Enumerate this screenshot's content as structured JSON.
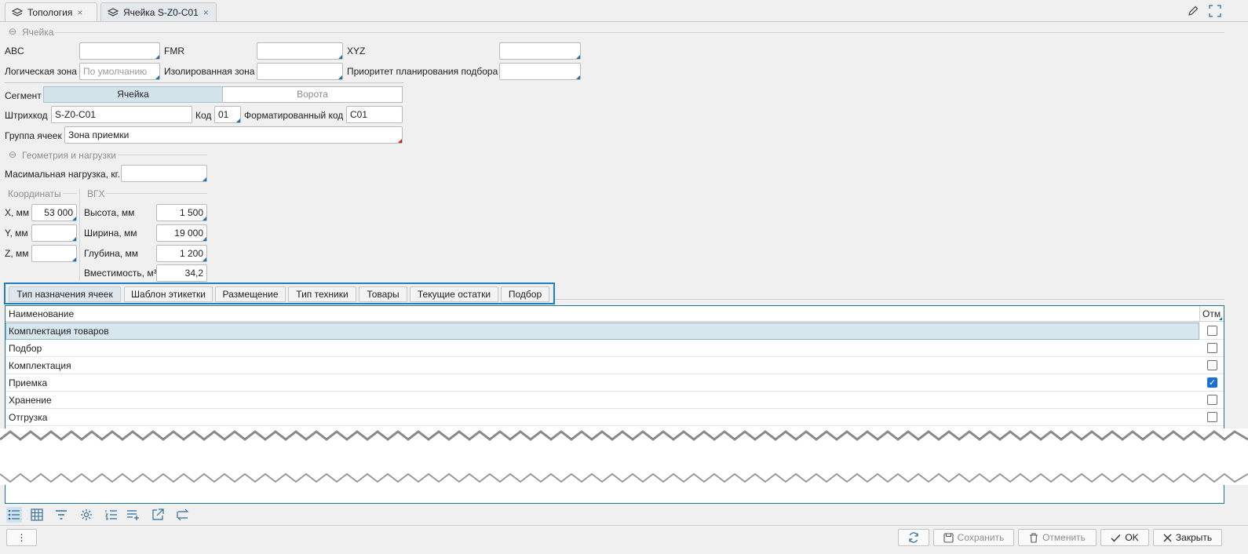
{
  "tabs": [
    {
      "label": "Топология",
      "icon": "layers-icon"
    },
    {
      "label": "Ячейка S-Z0-C01",
      "icon": "layers-icon"
    }
  ],
  "cell_section": {
    "title": "Ячейка",
    "abc_label": "ABC",
    "abc_value": "",
    "fmr_label": "FMR",
    "fmr_value": "",
    "xyz_label": "XYZ",
    "xyz_value": "",
    "logic_zone_label": "Логическая зона",
    "logic_zone_placeholder": "По умолчанию",
    "isolated_zone_label": "Изолированная зона",
    "isolated_zone_value": "",
    "priority_label": "Приоритет планирования подбора",
    "priority_value": ""
  },
  "segment": {
    "label": "Сегмент",
    "options": [
      "Ячейка",
      "Ворота"
    ],
    "selected": "Ячейка"
  },
  "barcode": {
    "label": "Штрихкод",
    "value": "S-Z0-C01"
  },
  "code": {
    "label": "Код",
    "value": "01"
  },
  "formatted_code": {
    "label": "Форматированный код",
    "value": "C01"
  },
  "cell_group": {
    "label": "Группа ячеек",
    "value": "Зона приемки"
  },
  "geometry": {
    "title": "Геометрия и нагрузки",
    "max_load_label": "Масимальная нагрузка, кг.",
    "max_load_value": "",
    "coords_title": "Координаты",
    "x_label": "X, мм",
    "x_value": "53 000",
    "y_label": "Y, мм",
    "y_value": "",
    "z_label": "Z, мм",
    "z_value": "",
    "vgh_title": "ВГХ",
    "height_label": "Высота, мм",
    "height_value": "1 500",
    "width_label": "Ширина, мм",
    "width_value": "19 000",
    "depth_label": "Глубина, мм",
    "depth_value": "1 200",
    "capacity_label": "Вместимость, м³",
    "capacity_value": "34,2"
  },
  "inner_tabs": [
    "Тип назначения ячеек",
    "Шаблон этикетки",
    "Размещение",
    "Тип техники",
    "Товары",
    "Текущие остатки",
    "Подбор"
  ],
  "grid": {
    "col_name": "Наименование",
    "col_mark": "Отм",
    "rows": [
      {
        "name": "Комплектация товаров",
        "checked": false
      },
      {
        "name": "Подбор",
        "checked": false
      },
      {
        "name": "Комплектация",
        "checked": false
      },
      {
        "name": "Приемка",
        "checked": true
      },
      {
        "name": "Хранение",
        "checked": false
      },
      {
        "name": "Отгрузка",
        "checked": false
      }
    ]
  },
  "footer": {
    "more_label": "⋮",
    "save": "Сохранить",
    "cancel": "Отменить",
    "ok": "OK",
    "close": "Закрыть"
  },
  "accent_color": "#1f7fc4"
}
